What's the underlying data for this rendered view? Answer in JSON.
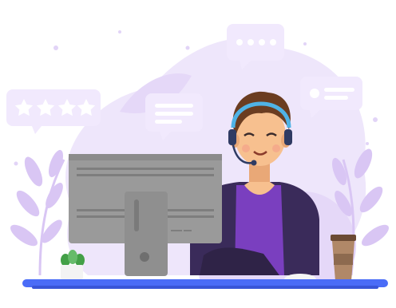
{
  "scene": {
    "description_tags": [
      "customer-support-agent",
      "headset",
      "computer",
      "coffee-cup",
      "plant",
      "chat-bubbles",
      "rating-stars"
    ],
    "colors": {
      "background": "#ffffff",
      "blob": "#eee6fb",
      "blob_dark": "#e2d4f7",
      "leaf": "#d9c6f4",
      "bubble": "#f1e9fd",
      "bubble_line": "#ffffff",
      "desk": "#4a6cf7",
      "desk_shadow": "#3955d8",
      "monitor": "#9a9a9a",
      "monitor_dark": "#7e7e7e",
      "shirt": "#7a3fbf",
      "jacket": "#3a2b5a",
      "skin": "#f7c08f",
      "hair": "#6b3d21",
      "headset": "#4fb3e6",
      "cup": "#b08868",
      "cup_lid": "#6b4a34",
      "pot": "#f3f3f3",
      "plant": "#4caf50"
    },
    "rating_stars": 4,
    "icons": [
      "star-icon",
      "chat-bubble-icon",
      "typing-dots-icon",
      "headset-icon"
    ]
  }
}
